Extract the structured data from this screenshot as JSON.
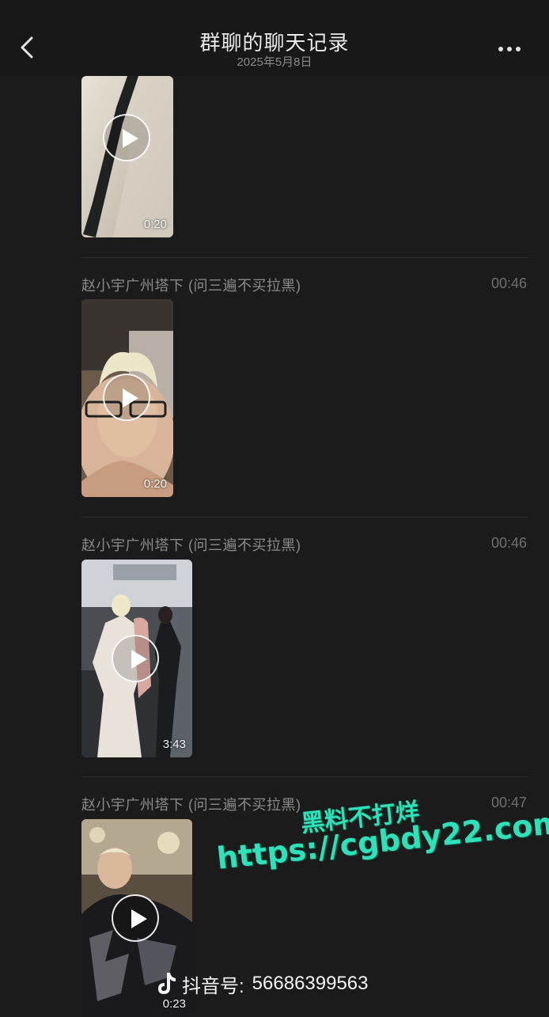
{
  "header": {
    "title": "群聊的聊天记录",
    "subtitle": "2025年5月8日",
    "back_icon": "chevron-left-icon",
    "more_icon": "more-horizontal-icon"
  },
  "messages": [
    {
      "sender": "",
      "time": "",
      "duration": "0:20"
    },
    {
      "sender": "赵小宇广州塔下 (问三遍不买拉黑)",
      "time": "00:46",
      "duration": "0:20"
    },
    {
      "sender": "赵小宇广州塔下 (问三遍不买拉黑)",
      "time": "00:46",
      "duration": "3:43"
    },
    {
      "sender": "赵小宇广州塔下 (问三遍不买拉黑)",
      "time": "00:47",
      "duration": "0:23"
    }
  ],
  "watermark": {
    "line1": "黑料不打烊",
    "line2": "https://cgbdy22.com",
    "douyin_label": "抖音号:",
    "douyin_id": "56686399563",
    "color": "#2fe0b8"
  }
}
